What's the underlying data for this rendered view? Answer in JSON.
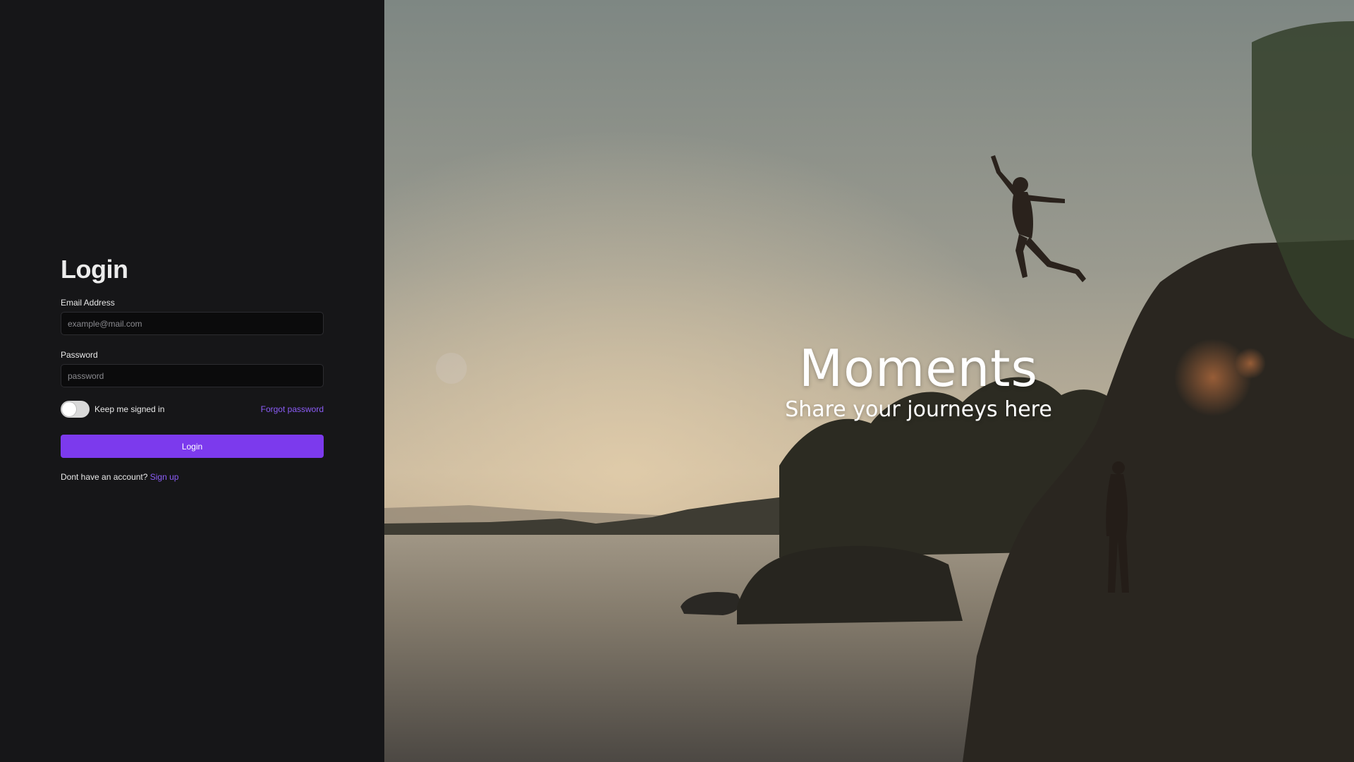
{
  "login": {
    "title": "Login",
    "email_label": "Email Address",
    "email_placeholder": "example@mail.com",
    "email_value": "",
    "password_label": "Password",
    "password_placeholder": "password",
    "password_value": "",
    "keep_signed_in_label": "Keep me signed in",
    "keep_signed_in_checked": false,
    "forgot_password_label": "Forgot password",
    "submit_label": "Login",
    "signup_prompt": "Dont have an account?",
    "signup_link": "Sign up"
  },
  "hero": {
    "title": "Moments",
    "subtitle": "Share your journeys here",
    "image": "sunset-lake-cliff-jump-photo"
  },
  "colors": {
    "panel_bg": "#161618",
    "accent": "#7c3aed",
    "input_bg": "#0b0b0c"
  }
}
